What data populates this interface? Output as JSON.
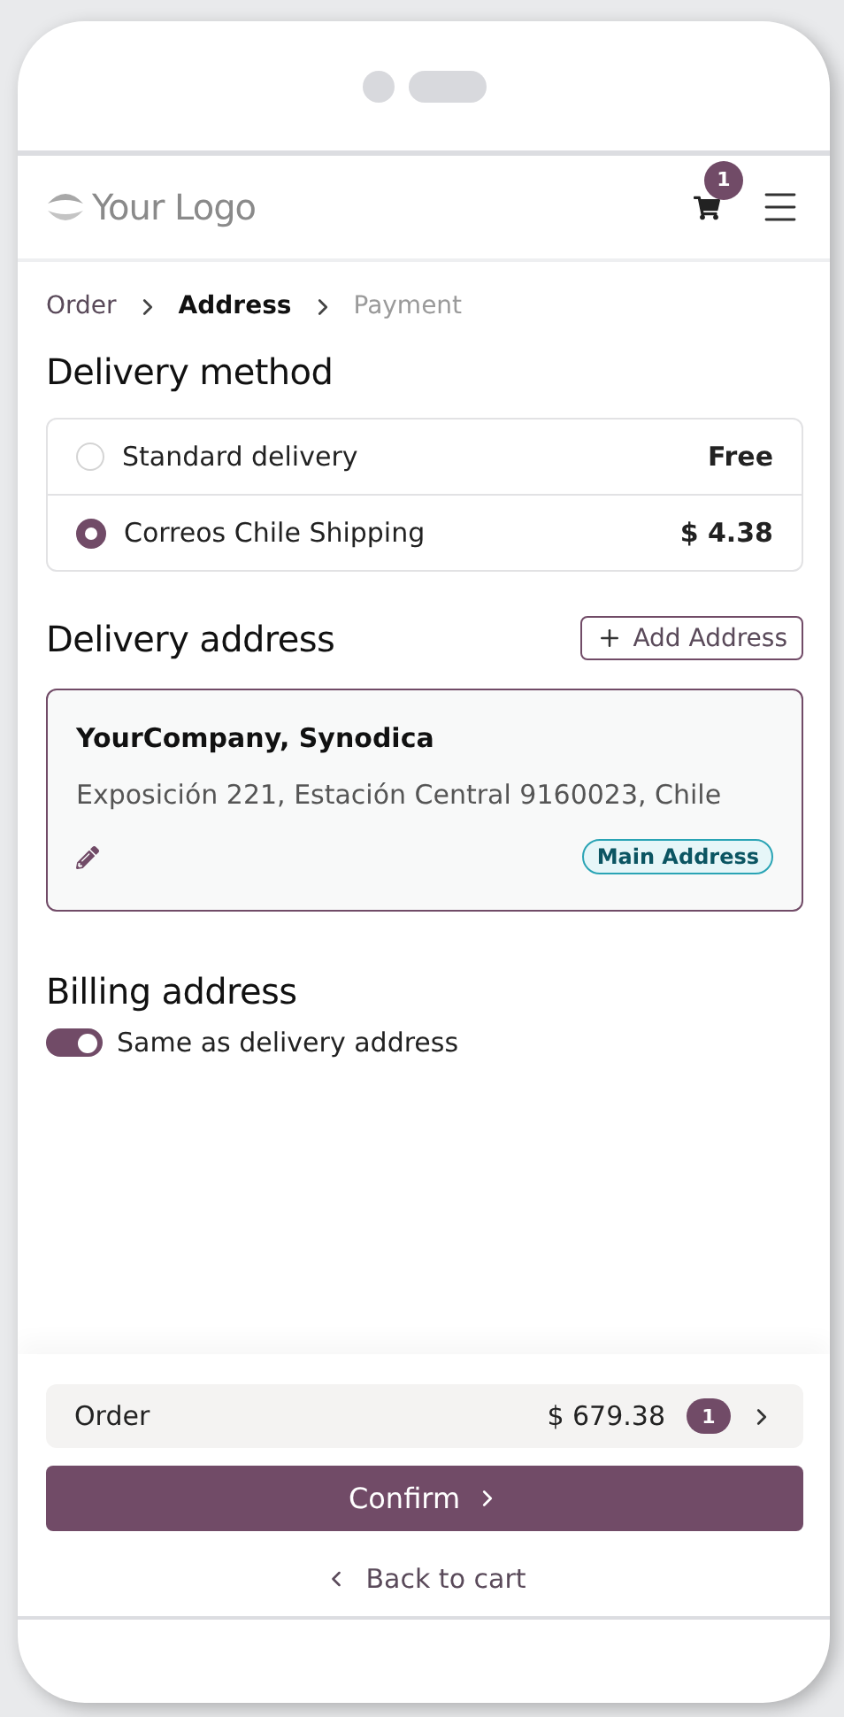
{
  "brand": {
    "logo": "Your Logo"
  },
  "header": {
    "cart_count": "1"
  },
  "breadcrumbs": [
    {
      "label": "Order",
      "selected": false,
      "completed": true
    },
    {
      "label": "Address",
      "selected": true,
      "completed": false
    },
    {
      "label": "Payment",
      "selected": false,
      "completed": false
    }
  ],
  "delivery": {
    "title": "Delivery method",
    "options": [
      {
        "label": "Standard delivery",
        "price": "Free",
        "selected": false
      },
      {
        "label": "Correos Chile Shipping",
        "price": "$ 4.38",
        "selected": true
      }
    ]
  },
  "address": {
    "title": "Delivery address",
    "add_button": "Add Address",
    "card": {
      "name": "YourCompany, Synodica",
      "line": "Exposición 221, Estación Central 9160023, Chile",
      "badge": "Main Address",
      "selected": true
    }
  },
  "billing": {
    "title": "Billing address",
    "toggle": {
      "label": "Same as delivery address",
      "on": true
    }
  },
  "summary": {
    "label": "Order",
    "total": "$ 679.38",
    "count": "1"
  },
  "confirm": "Confirm",
  "back": "Back to cart"
}
